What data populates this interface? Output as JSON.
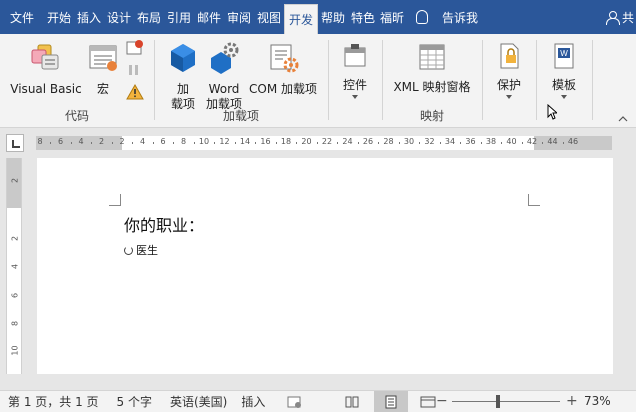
{
  "tabs": [
    {
      "label": "文件",
      "name": "tab-file"
    },
    {
      "label": "开始",
      "name": "tab-home"
    },
    {
      "label": "插入",
      "name": "tab-insert"
    },
    {
      "label": "设计",
      "name": "tab-design"
    },
    {
      "label": "布局",
      "name": "tab-layout"
    },
    {
      "label": "引用",
      "name": "tab-references"
    },
    {
      "label": "邮件",
      "name": "tab-mailings"
    },
    {
      "label": "审阅",
      "name": "tab-review"
    },
    {
      "label": "视图",
      "name": "tab-view"
    },
    {
      "label": "开发",
      "name": "tab-developer"
    },
    {
      "label": "帮助",
      "name": "tab-help"
    },
    {
      "label": "特色",
      "name": "tab-featured"
    },
    {
      "label": "福昕",
      "name": "tab-foxit"
    }
  ],
  "active_tab": "开发",
  "tell_me": "告诉我",
  "share": "共",
  "ribbon": {
    "code": {
      "label": "代码",
      "visual_basic": "Visual Basic",
      "macros": "宏"
    },
    "addins": {
      "label": "加载项",
      "addins_btn": [
        "加",
        "载项"
      ],
      "word_addins": [
        "Word",
        "加载项"
      ],
      "com_addins": "COM 加载项"
    },
    "controls": {
      "label": "控件",
      "btn": "控件"
    },
    "mapping": {
      "label": "映射",
      "xml_pane": "XML 映射窗格"
    },
    "protect": {
      "btn": "保护"
    },
    "templates": {
      "btn": "模板"
    }
  },
  "ruler": {
    "h_ticks": [
      "8",
      "6",
      "4",
      "2",
      "2",
      "4",
      "6",
      "8",
      "10",
      "12",
      "14",
      "16",
      "18",
      "20",
      "22",
      "24",
      "26",
      "28",
      "30",
      "32",
      "34",
      "36",
      "38",
      "40",
      "42",
      "44",
      "46"
    ],
    "v_ticks": [
      "2",
      "2",
      "4",
      "6",
      "8",
      "10"
    ]
  },
  "document": {
    "heading": "你的职业：",
    "choice": "医生"
  },
  "status": {
    "page": "第 1 页，共 1 页",
    "words": "5 个字",
    "language": "英语(美国)",
    "mode": "插入",
    "zoom": "73%",
    "zoom_value": 0.73
  },
  "colors": {
    "accent": "#2b579a",
    "ribbon_bg": "#f3f3f3",
    "page_bg": "#ffffff",
    "canvas_bg": "#e6e6e6"
  }
}
